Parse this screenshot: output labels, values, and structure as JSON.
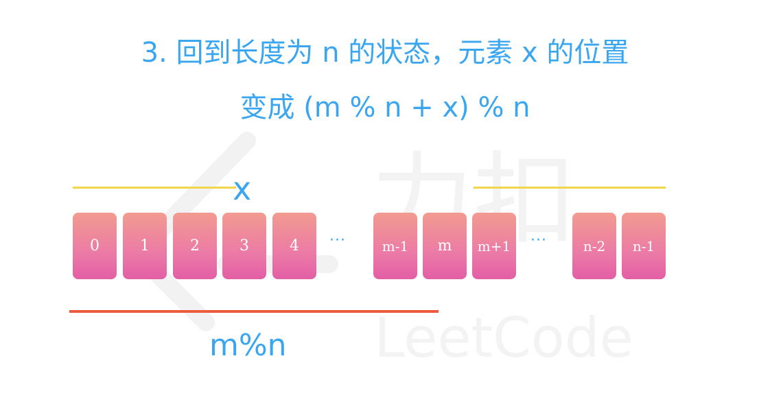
{
  "title": {
    "line1": "3. 回到长度为 n 的状态，元素 x 的位置",
    "line2": "变成 (m % n + x) % n"
  },
  "labels": {
    "x": "x",
    "m_mod_n": "m%n"
  },
  "cells": [
    {
      "id": "cell-0",
      "label": "0"
    },
    {
      "id": "cell-1",
      "label": "1"
    },
    {
      "id": "cell-2",
      "label": "2"
    },
    {
      "id": "cell-3",
      "label": "3"
    },
    {
      "id": "cell-4",
      "label": "4"
    },
    {
      "id": "ellipsis-1",
      "label": "···"
    },
    {
      "id": "cell-m-minus-1",
      "label": "m-1"
    },
    {
      "id": "cell-m",
      "label": "m"
    },
    {
      "id": "cell-m-plus-1",
      "label": "m+1"
    },
    {
      "id": "ellipsis-2",
      "label": "···"
    },
    {
      "id": "cell-n-minus-2",
      "label": "n-2"
    },
    {
      "id": "cell-n-minus-1",
      "label": "n-1"
    }
  ],
  "watermark": {
    "brand": "LeetCode",
    "chinese": "力扣"
  },
  "colors": {
    "title": "#3aa6ef",
    "bracket_yellow": "#f0d648",
    "bracket_red": "#ee5a3d",
    "cell_top": "#f29b90",
    "cell_bottom": "#e35ea5"
  }
}
